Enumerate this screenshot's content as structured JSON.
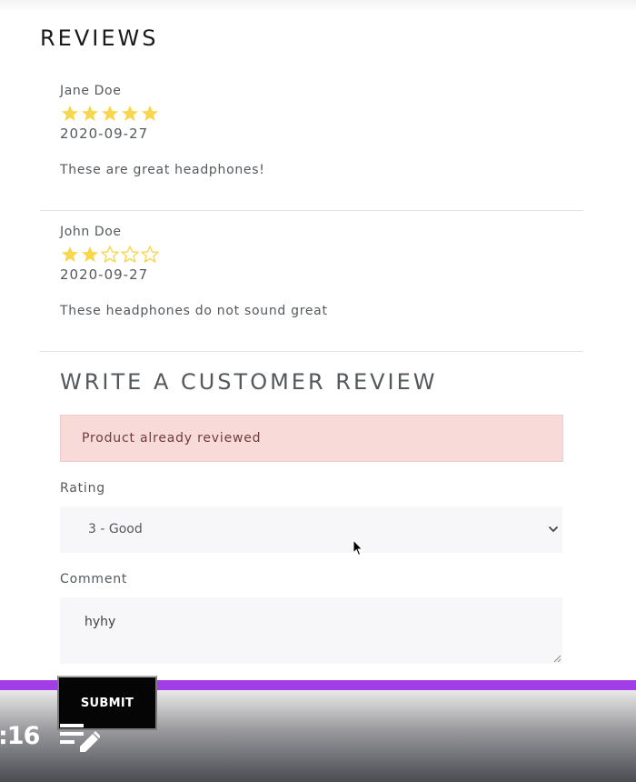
{
  "reviews_section": {
    "title": "REVIEWS",
    "reviews": [
      {
        "name": "Jane Doe",
        "rating": 5,
        "max_rating": 5,
        "date": "2020-09-27",
        "comment": "These are great headphones!"
      },
      {
        "name": "John Doe",
        "rating": 2,
        "max_rating": 5,
        "date": "2020-09-27",
        "comment": "These headphones do not sound great"
      }
    ]
  },
  "write_review": {
    "title": "WRITE A CUSTOMER REVIEW",
    "alert": "Product already reviewed",
    "rating_label": "Rating",
    "rating_selected": "3 - Good",
    "comment_label": "Comment",
    "comment_value": "hyhy",
    "submit_label": "SUBMIT"
  },
  "player": {
    "time": ":16",
    "playlist_icon": "playlist-edit-icon"
  },
  "colors": {
    "star": "#f8d64e",
    "alert_bg": "#f8dbd9",
    "alert_text": "#6f3b3b",
    "progress": "#a23ee8",
    "submit_bg": "#050505"
  }
}
